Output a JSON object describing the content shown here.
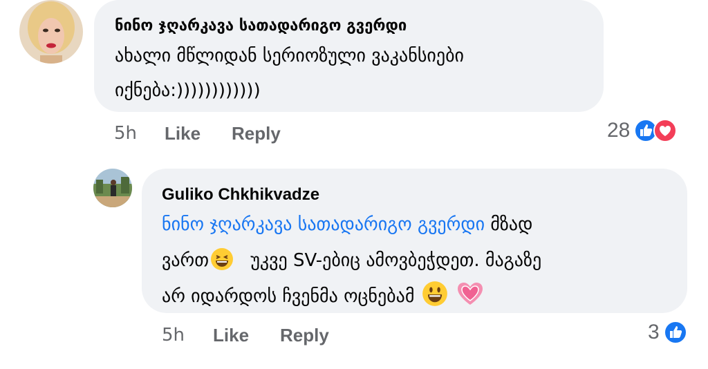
{
  "comment1": {
    "author": "ნინო ჯღარკავა სათადარიგო გვერდი",
    "line1": "ახალი მწლიდან სერიოზული ვაკანსიები",
    "line2": "იქნება:))))))))))))",
    "time": "5h",
    "like": "Like",
    "reply": "Reply",
    "reaction_count": "28",
    "reactions": [
      "like-icon",
      "love-icon"
    ]
  },
  "comment2": {
    "author": "Guliko Chkhikvadze",
    "mention": "ნინო ჯღარკავა სათადარიგო გვერდი",
    "line1_rest": "მზად",
    "line2_a": "ვართ",
    "line2_b": "უკვე  SV-ებიც ამოვბეჭდეთ. მაგაზე",
    "line3": "არ იდარდოს ჩვენმა ოცნებამ",
    "time": "5h",
    "like": "Like",
    "reply": "Reply",
    "reaction_count": "3",
    "reactions": [
      "like-icon"
    ]
  },
  "colors": {
    "bubble": "#f0f2f5",
    "mention": "#1876f2",
    "meta": "#65676b",
    "like": "#1877f2",
    "love": "#f33e58"
  }
}
